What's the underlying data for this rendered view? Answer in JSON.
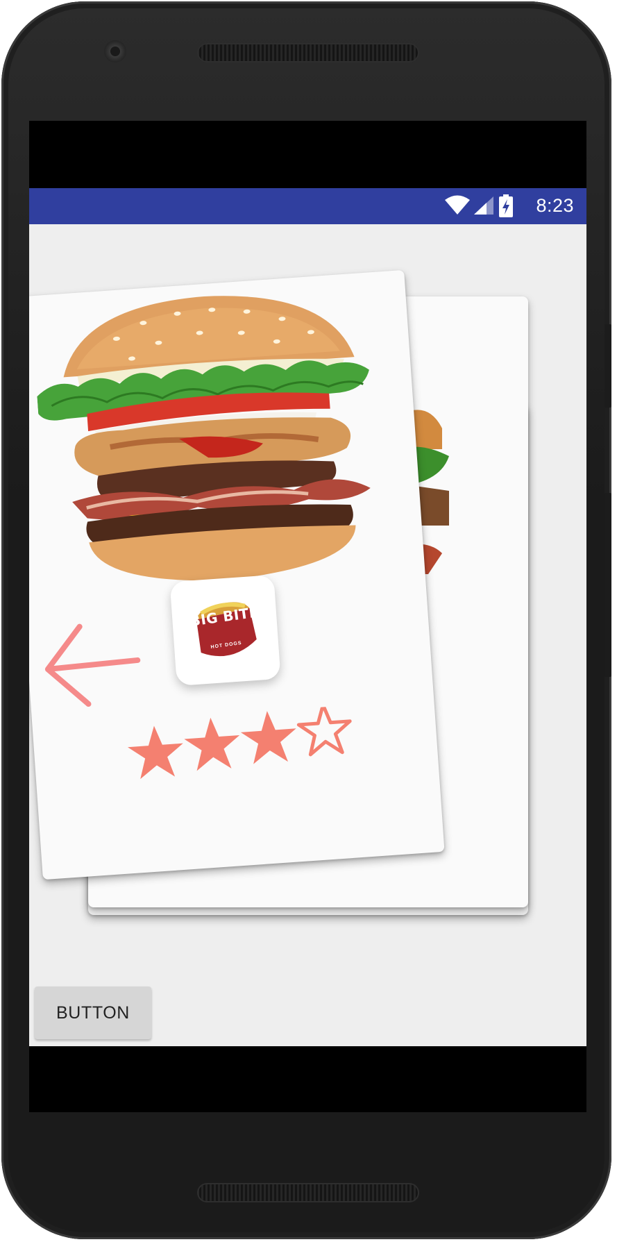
{
  "status_bar": {
    "time": "8:23",
    "icons": [
      "wifi-icon",
      "cell-signal-icon",
      "battery-charging-icon"
    ],
    "background": "#303f9f"
  },
  "card": {
    "image": "burger-image",
    "logo": {
      "brand_text": "BIG BITE",
      "sub_text": "HOT DOGS"
    },
    "rating": {
      "value": 3,
      "max": 4,
      "color": "#f48070"
    },
    "back_arrow_color": "#f58a8a"
  },
  "button": {
    "label": "BUTTON"
  }
}
